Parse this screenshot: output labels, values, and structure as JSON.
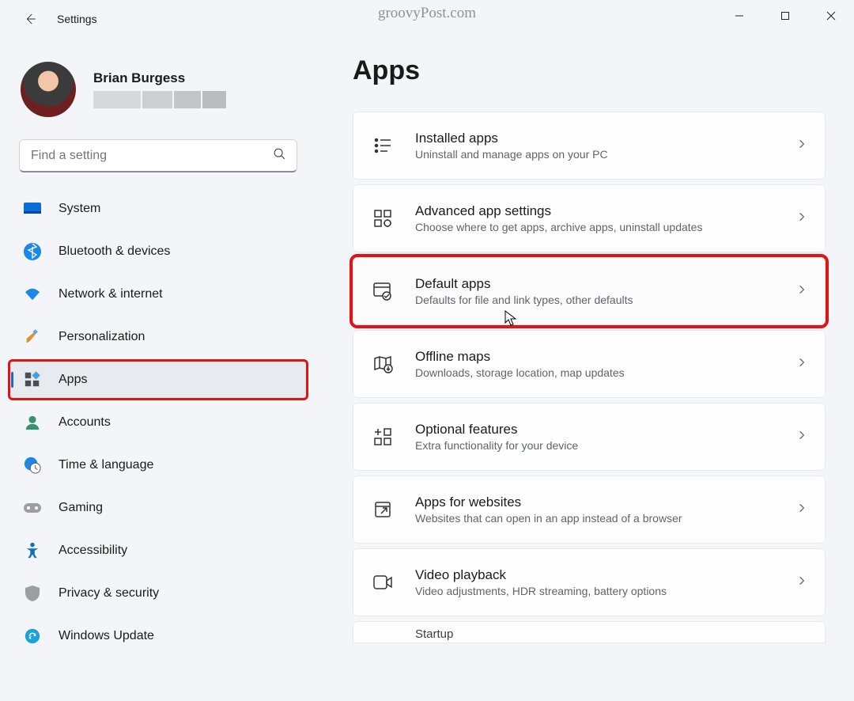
{
  "window": {
    "title": "Settings",
    "watermark": "groovyPost.com"
  },
  "profile": {
    "name": "Brian Burgess"
  },
  "search": {
    "placeholder": "Find a setting"
  },
  "sidebar": {
    "items": [
      {
        "label": "System"
      },
      {
        "label": "Bluetooth & devices"
      },
      {
        "label": "Network & internet"
      },
      {
        "label": "Personalization"
      },
      {
        "label": "Apps"
      },
      {
        "label": "Accounts"
      },
      {
        "label": "Time & language"
      },
      {
        "label": "Gaming"
      },
      {
        "label": "Accessibility"
      },
      {
        "label": "Privacy & security"
      },
      {
        "label": "Windows Update"
      }
    ]
  },
  "page": {
    "title": "Apps",
    "partial": "Startup"
  },
  "cards": [
    {
      "title": "Installed apps",
      "sub": "Uninstall and manage apps on your PC"
    },
    {
      "title": "Advanced app settings",
      "sub": "Choose where to get apps, archive apps, uninstall updates"
    },
    {
      "title": "Default apps",
      "sub": "Defaults for file and link types, other defaults"
    },
    {
      "title": "Offline maps",
      "sub": "Downloads, storage location, map updates"
    },
    {
      "title": "Optional features",
      "sub": "Extra functionality for your device"
    },
    {
      "title": "Apps for websites",
      "sub": "Websites that can open in an app instead of a browser"
    },
    {
      "title": "Video playback",
      "sub": "Video adjustments, HDR streaming, battery options"
    }
  ]
}
